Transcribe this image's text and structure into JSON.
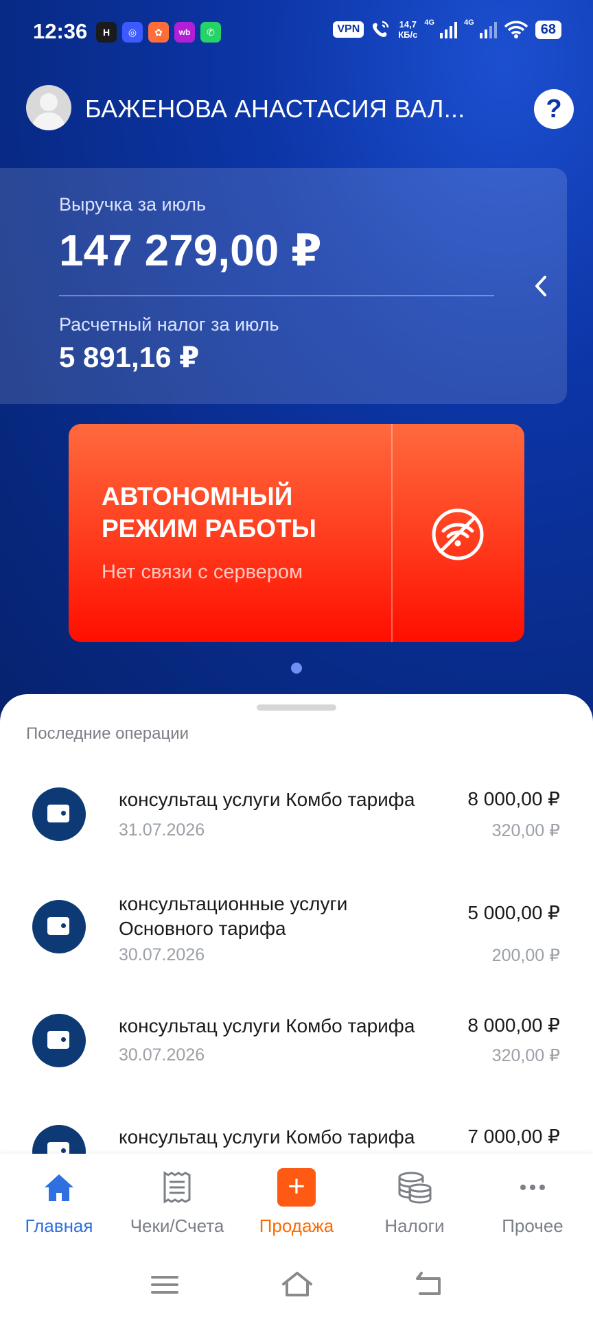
{
  "status_bar": {
    "time": "12:36",
    "apps": [
      {
        "icon": "app-h-icon",
        "glyph": "H",
        "color": "#1b1b1b"
      },
      {
        "icon": "app-chat-icon",
        "glyph": "◎",
        "color": "#3d5afe"
      },
      {
        "icon": "app-multi-icon",
        "glyph": "✿",
        "color": "#ff6d3a"
      },
      {
        "icon": "app-wb-icon",
        "glyph": "wb",
        "color": "#b31fd6"
      },
      {
        "icon": "whatsapp-icon",
        "glyph": "✆",
        "color": "#25d366"
      }
    ],
    "vpn": "VPN",
    "speed_value": "14,7",
    "speed_unit": "КБ/с",
    "net1": "4G",
    "net2": "4G",
    "battery": "68"
  },
  "header": {
    "user_name": "БАЖЕНОВА АНАСТАСИЯ ВАЛ...",
    "help": "?"
  },
  "revenue": {
    "label": "Выручка за июль",
    "value": "147 279,00 ₽",
    "tax_label": "Расчетный налог за июль",
    "tax_value": "5 891,16 ₽"
  },
  "offline": {
    "title": "АВТОНОМНЫЙ РЕЖИМ РАБОТЫ",
    "subtitle": "Нет связи с сервером"
  },
  "operations": {
    "title": "Последние операции",
    "items": [
      {
        "name": "консультац услуги Комбо тарифа",
        "date": "31.07.2026",
        "amount": "8 000,00 ₽",
        "tax": "320,00 ₽"
      },
      {
        "name": "консультационные услуги Основного тарифа",
        "date": "30.07.2026",
        "amount": "5 000,00 ₽",
        "tax": "200,00 ₽"
      },
      {
        "name": "консультац услуги Комбо тарифа",
        "date": "30.07.2026",
        "amount": "8 000,00 ₽",
        "tax": "320,00 ₽"
      },
      {
        "name": "консультац услуги Комбо тарифа",
        "date": "",
        "amount": "7 000,00 ₽",
        "tax": ""
      }
    ]
  },
  "nav": [
    {
      "label": "Главная",
      "icon": "home-icon"
    },
    {
      "label": "Чеки/Счета",
      "icon": "receipt-icon"
    },
    {
      "label": "Продажа",
      "icon": "plus-icon"
    },
    {
      "label": "Налоги",
      "icon": "coins-icon"
    },
    {
      "label": "Прочее",
      "icon": "more-icon"
    }
  ],
  "colors": {
    "brand_blue": "#0c35a6",
    "accent_orange": "#ff5a14",
    "active_nav": "#2f6fe0",
    "offline_red": "#ff2a10"
  }
}
